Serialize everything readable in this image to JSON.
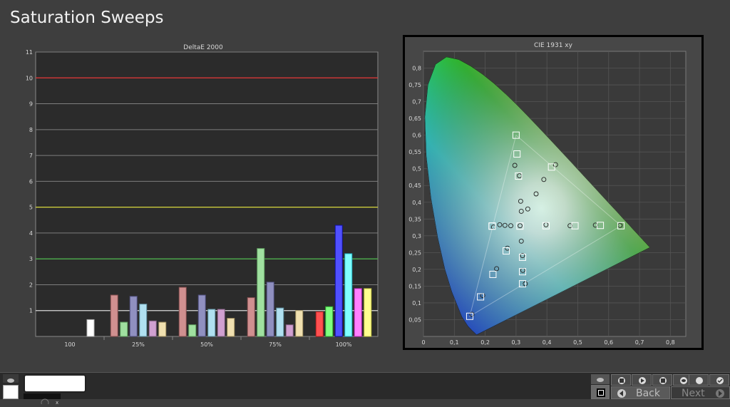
{
  "page": {
    "title": "Saturation Sweeps"
  },
  "colors": {
    "red": "#e03030",
    "green": "#50e050",
    "blue": "#3030ee",
    "cyan": "#30e0f0",
    "magenta": "#f040f0",
    "yellow": "#f0f040"
  },
  "chart_data": [
    {
      "type": "bar",
      "title": "DeltaE 2000",
      "categories": [
        "100",
        "25%",
        "50%",
        "75%",
        "100%"
      ],
      "ylim": [
        0,
        11
      ],
      "yticks": [
        1,
        2,
        3,
        4,
        5,
        6,
        7,
        8,
        9,
        10,
        11
      ],
      "threshold_lines": [
        {
          "y": 1.0,
          "color": "#d0d0d0"
        },
        {
          "y": 3.0,
          "color": "#4cae4c"
        },
        {
          "y": 5.0,
          "color": "#d6d63a"
        },
        {
          "y": 10.0,
          "color": "#e03030"
        }
      ],
      "series": [
        {
          "color": "red",
          "values": [
            null,
            1.6,
            1.9,
            1.5,
            0.95
          ]
        },
        {
          "color": "green",
          "values": [
            null,
            0.55,
            0.45,
            3.4,
            1.15
          ]
        },
        {
          "color": "blue",
          "values": [
            null,
            1.55,
            1.6,
            2.1,
            4.3
          ]
        },
        {
          "color": "cyan",
          "values": [
            null,
            1.25,
            1.05,
            1.1,
            3.2
          ]
        },
        {
          "color": "magenta",
          "values": [
            null,
            0.6,
            1.05,
            0.45,
            1.85
          ]
        },
        {
          "color": "yellow",
          "values": [
            null,
            0.55,
            0.7,
            1.0,
            1.85
          ]
        },
        {
          "color": "white",
          "values": [
            0.65,
            null,
            null,
            null,
            null
          ]
        }
      ],
      "grid": true
    },
    {
      "type": "scatter",
      "title": "CIE 1931 xy",
      "xlim": [
        0,
        0.85
      ],
      "ylim": [
        0,
        0.85
      ],
      "xticks": [
        "0",
        "0,1",
        "0,2",
        "0,3",
        "0,4",
        "0,5",
        "0,6",
        "0,7",
        "0,8"
      ],
      "yticks": [
        "0,05",
        "0,1",
        "0,15",
        "0,2",
        "0,25",
        "0,3",
        "0,35",
        "0,4",
        "0,45",
        "0,5",
        "0,55",
        "0,6",
        "0,65",
        "0,7",
        "0,75",
        "0,8"
      ],
      "gamut_triangle": [
        [
          0.64,
          0.33
        ],
        [
          0.3,
          0.6
        ],
        [
          0.15,
          0.06
        ]
      ],
      "targets": [
        [
          0.3127,
          0.329
        ],
        [
          0.397,
          0.33
        ],
        [
          0.491,
          0.33
        ],
        [
          0.573,
          0.331
        ],
        [
          0.64,
          0.33
        ],
        [
          0.308,
          0.478
        ],
        [
          0.303,
          0.544
        ],
        [
          0.3,
          0.6
        ],
        [
          0.268,
          0.255
        ],
        [
          0.225,
          0.185
        ],
        [
          0.185,
          0.118
        ],
        [
          0.15,
          0.06
        ],
        [
          0.2225,
          0.329
        ],
        [
          0.2225,
          0.329
        ],
        [
          0.321,
          0.236
        ],
        [
          0.321,
          0.193
        ],
        [
          0.321,
          0.157
        ],
        [
          0.415,
          0.505
        ]
      ],
      "measured": [
        [
          0.313,
          0.33
        ],
        [
          0.397,
          0.333
        ],
        [
          0.475,
          0.33
        ],
        [
          0.557,
          0.332
        ],
        [
          0.637,
          0.331
        ],
        [
          0.311,
          0.479
        ],
        [
          0.315,
          0.403
        ],
        [
          0.317,
          0.373
        ],
        [
          0.296,
          0.51
        ],
        [
          0.272,
          0.263
        ],
        [
          0.237,
          0.202
        ],
        [
          0.192,
          0.122
        ],
        [
          0.157,
          0.066
        ],
        [
          0.247,
          0.333
        ],
        [
          0.264,
          0.331
        ],
        [
          0.283,
          0.33
        ],
        [
          0.227,
          0.326
        ],
        [
          0.317,
          0.284
        ],
        [
          0.321,
          0.241
        ],
        [
          0.322,
          0.197
        ],
        [
          0.33,
          0.157
        ],
        [
          0.338,
          0.38
        ],
        [
          0.365,
          0.425
        ],
        [
          0.39,
          0.468
        ],
        [
          0.428,
          0.512
        ]
      ]
    }
  ],
  "toolbar": {
    "back_label": "Back",
    "next_label": "Next"
  }
}
